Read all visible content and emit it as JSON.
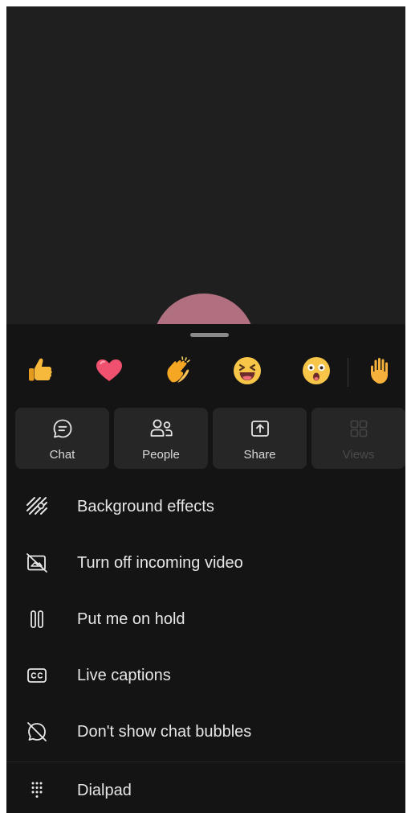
{
  "reactions": [
    {
      "name": "like",
      "icon": "thumbs-up-icon"
    },
    {
      "name": "heart",
      "icon": "heart-icon"
    },
    {
      "name": "applause",
      "icon": "clapping-hands-icon"
    },
    {
      "name": "laugh",
      "icon": "laughing-face-icon"
    },
    {
      "name": "surprised",
      "icon": "surprised-face-icon"
    },
    {
      "name": "raise-hand",
      "icon": "raised-hand-icon"
    }
  ],
  "tiles": [
    {
      "label": "Chat",
      "icon": "chat-icon",
      "enabled": true
    },
    {
      "label": "People",
      "icon": "people-icon",
      "enabled": true
    },
    {
      "label": "Share",
      "icon": "share-icon",
      "enabled": true
    },
    {
      "label": "Views",
      "icon": "views-grid-icon",
      "enabled": false
    }
  ],
  "menu": [
    {
      "label": "Background effects",
      "icon": "background-effects-icon"
    },
    {
      "label": "Turn off incoming video",
      "icon": "video-off-icon"
    },
    {
      "label": "Put me on hold",
      "icon": "pause-icon"
    },
    {
      "label": "Live captions",
      "icon": "captions-icon"
    },
    {
      "label": "Don't show chat bubbles",
      "icon": "chat-bubbles-off-icon"
    },
    {
      "label": "Dialpad",
      "icon": "dialpad-icon"
    }
  ],
  "colors": {
    "sheet_background": "#141414",
    "tile_background": "#262626",
    "avatar": "#b0707f"
  }
}
